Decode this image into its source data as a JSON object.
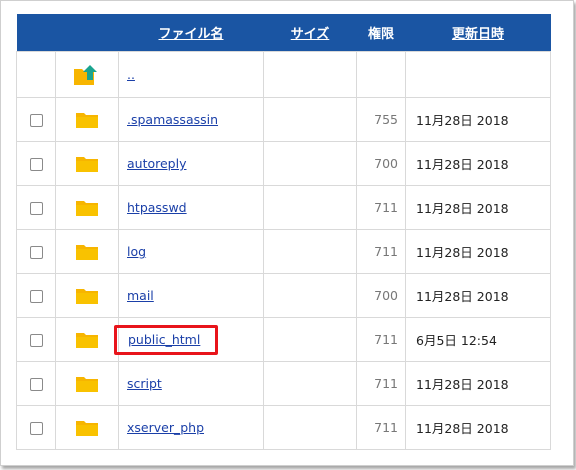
{
  "headers": {
    "name": "ファイル名",
    "size": "サイズ",
    "permission": "権限",
    "modified": "更新日時"
  },
  "parent": {
    "label": ".."
  },
  "rows": [
    {
      "name": ".spamassassin",
      "size": "",
      "perm": "755",
      "date": "11月28日 2018"
    },
    {
      "name": "autoreply",
      "size": "",
      "perm": "700",
      "date": "11月28日 2018"
    },
    {
      "name": "htpasswd",
      "size": "",
      "perm": "711",
      "date": "11月28日 2018"
    },
    {
      "name": "log",
      "size": "",
      "perm": "711",
      "date": "11月28日 2018"
    },
    {
      "name": "mail",
      "size": "",
      "perm": "700",
      "date": "11月28日 2018"
    },
    {
      "name": "public_html",
      "size": "",
      "perm": "711",
      "date": "6月5日 12:54"
    },
    {
      "name": "script",
      "size": "",
      "perm": "711",
      "date": "11月28日 2018"
    },
    {
      "name": "xserver_php",
      "size": "",
      "perm": "711",
      "date": "11月28日 2018"
    }
  ],
  "highlighted_row": "public_html",
  "colors": {
    "header_bg": "#1a55a3",
    "folder": "#f7b500",
    "link": "#1a3fa8",
    "highlight": "#e8141b"
  },
  "icons": {
    "parent": "folder-up-icon",
    "row": "folder-icon"
  }
}
